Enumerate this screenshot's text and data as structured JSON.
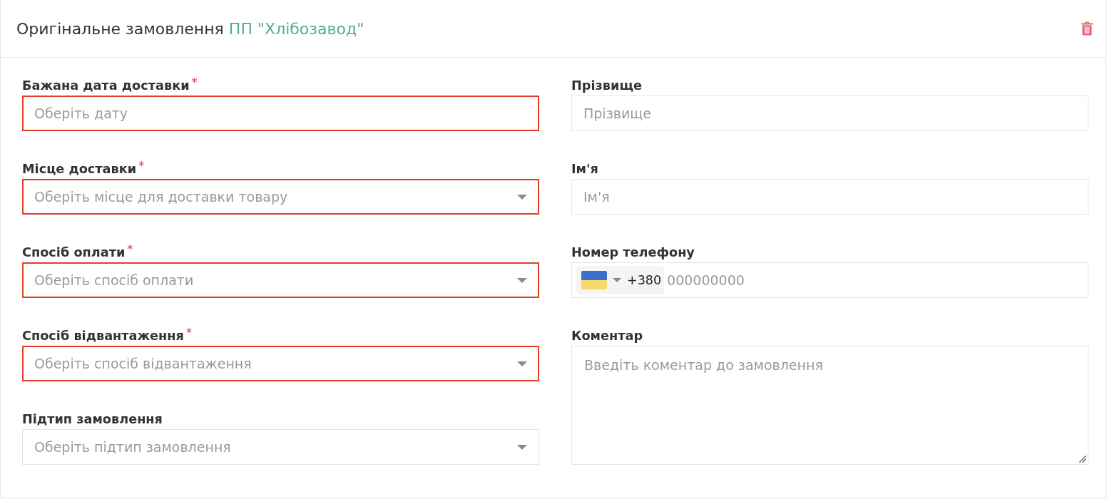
{
  "header": {
    "title": "Оригінальне замовлення",
    "company": "ПП \"Хлібозавод\""
  },
  "left_fields": [
    {
      "kind": "date",
      "label": "Бажана дата доставки",
      "required_mark": "*",
      "invalid": true,
      "placeholder": "Оберіть дату"
    },
    {
      "kind": "select",
      "label": "Місце доставки",
      "required_mark": "*",
      "invalid": true,
      "placeholder": "Оберіть місце для доставки товару"
    },
    {
      "kind": "select",
      "label": "Спосіб оплати",
      "required_mark": "*",
      "invalid": true,
      "placeholder": "Оберіть спосіб оплати"
    },
    {
      "kind": "select",
      "label": "Спосіб відвантаження",
      "required_mark": "*",
      "invalid": true,
      "placeholder": "Оберіть спосіб відвантаження"
    },
    {
      "kind": "select",
      "label": "Підтип замовлення",
      "invalid": false,
      "placeholder": "Оберіть підтип замовлення"
    }
  ],
  "right_fields": [
    {
      "kind": "text",
      "label": "Прізвище",
      "invalid": false,
      "placeholder": "Прізвище"
    },
    {
      "kind": "text",
      "label": "Ім'я",
      "invalid": false,
      "placeholder": "Ім'я"
    },
    {
      "kind": "phone",
      "label": "Номер телефону",
      "invalid": false,
      "dial_code": "+380",
      "placeholder": "000000000"
    },
    {
      "kind": "textarea",
      "label": "Коментар",
      "invalid": false,
      "placeholder": "Введіть коментар до замовлення"
    }
  ]
}
